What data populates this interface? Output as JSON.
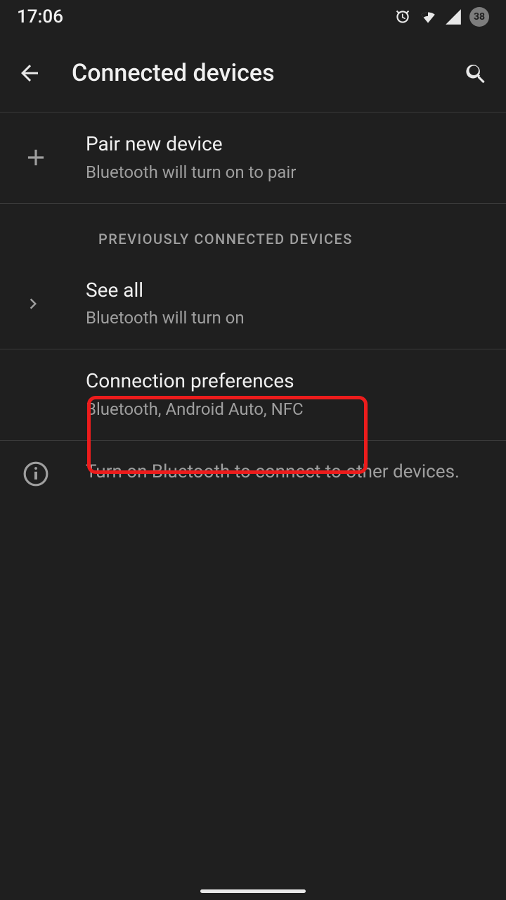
{
  "statusbar": {
    "time": "17:06",
    "battery": "38"
  },
  "header": {
    "title": "Connected devices"
  },
  "pair": {
    "title": "Pair new device",
    "subtitle": "Bluetooth will turn on to pair"
  },
  "sectionHeader": "PREVIOUSLY CONNECTED DEVICES",
  "seeAll": {
    "title": "See all",
    "subtitle": "Bluetooth will turn on"
  },
  "connPrefs": {
    "title": "Connection preferences",
    "subtitle": "Bluetooth, Android Auto, NFC"
  },
  "info": {
    "text": "Turn on Bluetooth to connect to other devices."
  }
}
